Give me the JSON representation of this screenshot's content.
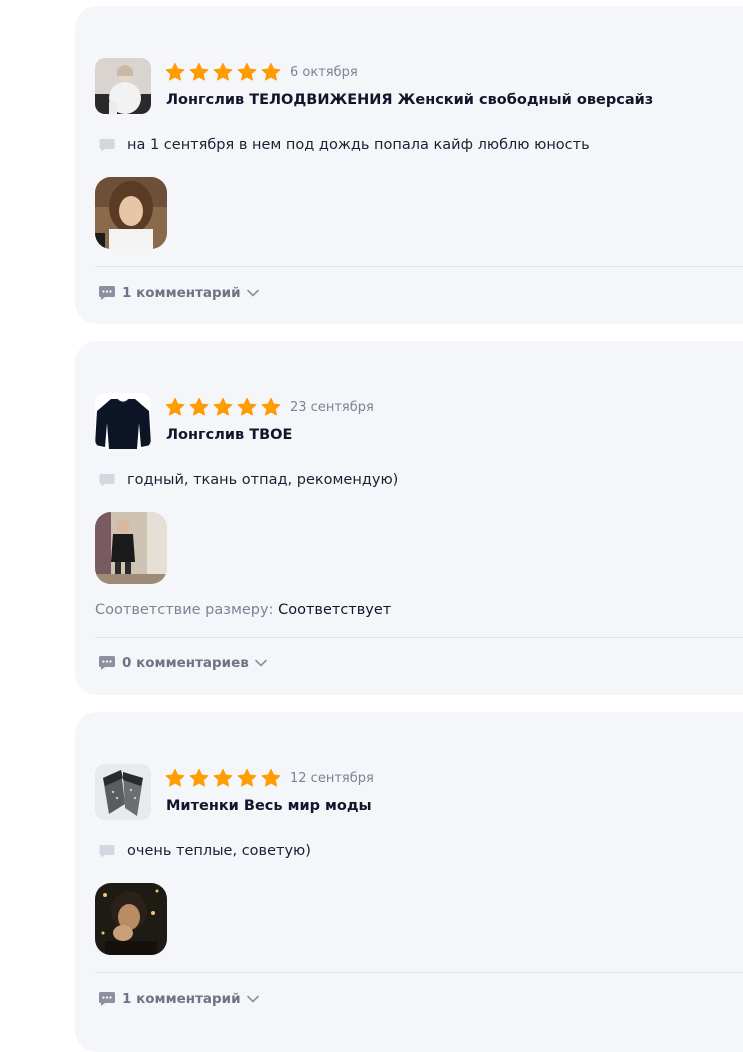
{
  "colors": {
    "card_bg": "#f5f6f9",
    "star": "#ff9d00",
    "muted": "#7d8393",
    "title": "#14142b",
    "divider": "#e1e3e9"
  },
  "reviews": [
    {
      "rating": 5,
      "date": "6 октября",
      "product": "Лонгслив ТЕЛОДВИЖЕНИЯ Женский свободный оверсайз",
      "text": "на 1 сентября в нем под дождь попала кайф люблю юность",
      "size_label": "",
      "size_value": "",
      "comments": "1 комментарий"
    },
    {
      "rating": 5,
      "date": "23 сентября",
      "product": "Лонгслив ТВОЕ",
      "text": "годный, ткань отпад, рекомендую)",
      "size_label": "Соответствие размеру: ",
      "size_value": "Соответствует",
      "comments": "0 комментариев"
    },
    {
      "rating": 5,
      "date": "12 сентября",
      "product": "Митенки Весь мир моды",
      "text": "очень теплые, советую)",
      "size_label": "",
      "size_value": "",
      "comments": "1 комментарий"
    }
  ]
}
